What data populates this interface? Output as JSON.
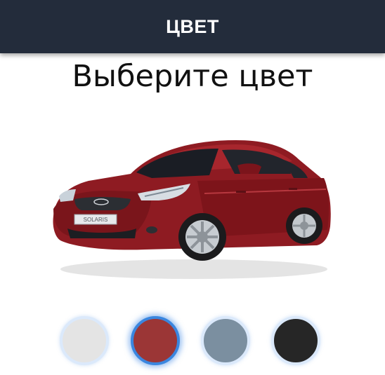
{
  "header": {
    "title": "ЦВЕТ"
  },
  "main": {
    "title": "Выберите цвет"
  },
  "car": {
    "selected_color": "#8e1b22",
    "name": "SOLARIS"
  },
  "colors": [
    {
      "hex": "#e4e4e4",
      "selected": false
    },
    {
      "hex": "#9b3636",
      "selected": true
    },
    {
      "hex": "#7b8fa0",
      "selected": false
    },
    {
      "hex": "#262626",
      "selected": false
    }
  ]
}
